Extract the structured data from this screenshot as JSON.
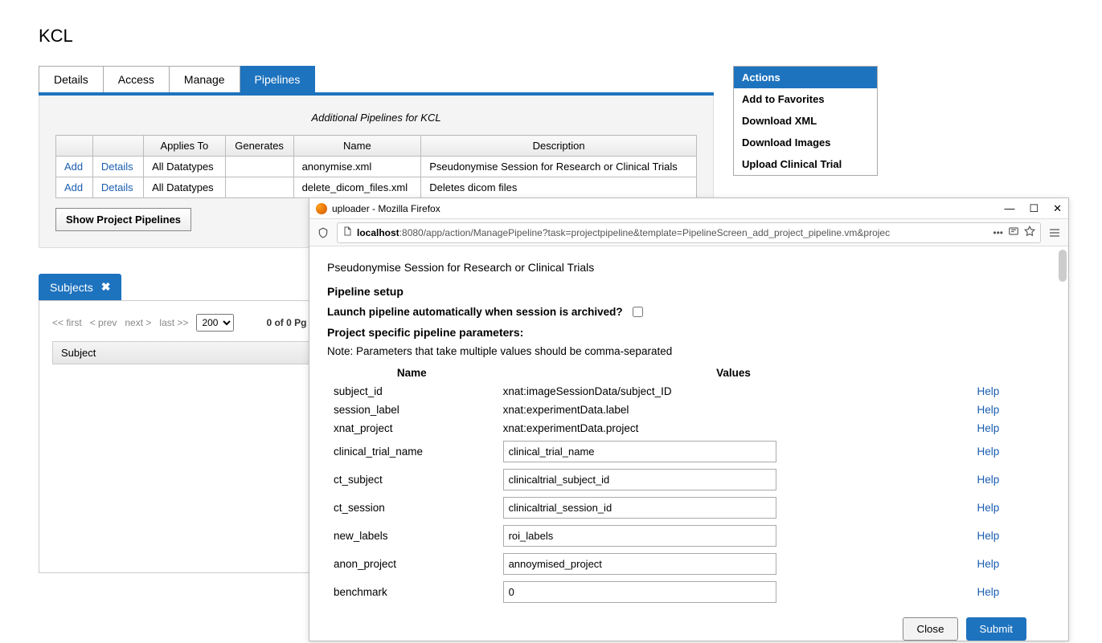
{
  "page_title": "KCL",
  "tabs": [
    "Details",
    "Access",
    "Manage",
    "Pipelines"
  ],
  "active_tab": 3,
  "panel": {
    "caption": "Additional Pipelines for KCL",
    "columns": [
      "",
      "",
      "Applies To",
      "Generates",
      "Name",
      "Description"
    ],
    "rows": [
      {
        "add": "Add",
        "details": "Details",
        "applies": "All Datatypes",
        "generates": "",
        "name": "anonymise.xml",
        "desc": "Pseudonymise Session for Research or Clinical Trials"
      },
      {
        "add": "Add",
        "details": "Details",
        "applies": "All Datatypes",
        "generates": "",
        "name": "delete_dicom_files.xml",
        "desc": "Deletes dicom files"
      }
    ],
    "show_button": "Show Project Pipelines"
  },
  "actions": {
    "header": "Actions",
    "items": [
      "Add to Favorites",
      "Download XML",
      "Download Images",
      "Upload Clinical Trial"
    ]
  },
  "subjects": {
    "tab_label": "Subjects",
    "pager": {
      "first": "<< first",
      "prev": "< prev",
      "next": "next >",
      "last": "last >>",
      "page_size": "200",
      "status": "0 of 0 Pg"
    },
    "header": "Subject"
  },
  "firefox": {
    "title": "uploader - Mozilla Firefox",
    "url_host": "localhost",
    "url_port": ":8080",
    "url_path": "/app/action/ManagePipeline?task=projectpipeline&template=PipelineScreen_add_project_pipeline.vm&projec",
    "content": {
      "heading": "Pseudonymise Session for Research or Clinical Trials",
      "setup_h": "Pipeline setup",
      "launch_label": "Launch pipeline automatically when session is archived?",
      "params_h": "Project specific pipeline parameters:",
      "note": "Note: Parameters that take multiple values should be comma-separated",
      "table_heads": {
        "name": "Name",
        "values": "Values"
      },
      "rows": [
        {
          "name": "subject_id",
          "value": "xnat:imageSessionData/subject_ID",
          "editable": false
        },
        {
          "name": "session_label",
          "value": "xnat:experimentData.label",
          "editable": false
        },
        {
          "name": "xnat_project",
          "value": "xnat:experimentData.project",
          "editable": false
        },
        {
          "name": "clinical_trial_name",
          "value": "clinical_trial_name",
          "editable": true
        },
        {
          "name": "ct_subject",
          "value": "clinicaltrial_subject_id",
          "editable": true
        },
        {
          "name": "ct_session",
          "value": "clinicaltrial_session_id",
          "editable": true
        },
        {
          "name": "new_labels",
          "value": "roi_labels",
          "editable": true
        },
        {
          "name": "anon_project",
          "value": "annoymised_project",
          "editable": true
        },
        {
          "name": "benchmark",
          "value": "0",
          "editable": true
        }
      ],
      "help_label": "Help",
      "close": "Close",
      "submit": "Submit"
    }
  }
}
